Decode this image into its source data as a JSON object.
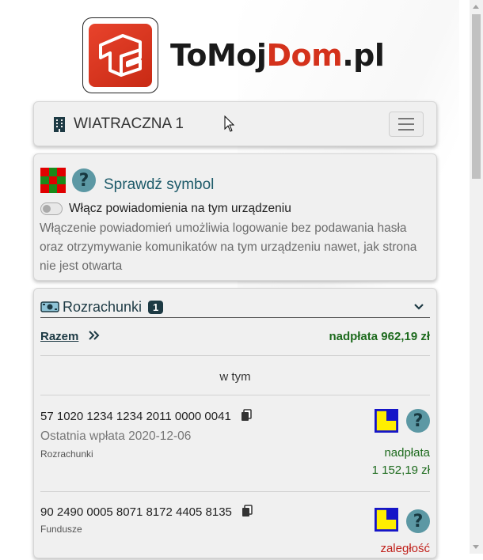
{
  "logo": {
    "text_dark_1": "ToMoj",
    "text_red": "Dom",
    "text_dark_2": ".pl"
  },
  "navbar": {
    "title": "WIATRACZNA 1"
  },
  "info": {
    "check_symbol_label": "Sprawdź symbol",
    "help_glyph": "?",
    "notifications_label": "Włącz powiadomienia na tym urządzeniu",
    "notifications_enabled": false,
    "notifications_description": "Włączenie powiadomień umożliwia logowanie bez podawania hasła oraz otrzymywanie komunikatów na tym urządzeniu nawet, jak strona nie jest otwarta"
  },
  "accounts": {
    "title": "Rozrachunki",
    "badge": "1",
    "total_label": "Razem",
    "total_value": "nadpłata 962,19 zł",
    "in_that_label": "w tym",
    "items": [
      {
        "number": "57 1020 1234 1234 2011 0000 0041",
        "last_payment": "Ostatnia wpłata 2020-12-06",
        "type": "Rozrachunki",
        "status_label": "nadpłata",
        "status_value": "1 152,19 zł",
        "status_color": "#1e6b1e"
      },
      {
        "number": "90 2490 0005 8071 8172 4405 8135",
        "type": "Fundusze",
        "status_label": "zaległość",
        "status_color": "#c0201a"
      }
    ]
  },
  "colors": {
    "accent": "#1d3a44",
    "brand_red": "#d4321c",
    "help": "#5c98a4",
    "positive": "#1e6b1e",
    "negative": "#c0201a"
  }
}
